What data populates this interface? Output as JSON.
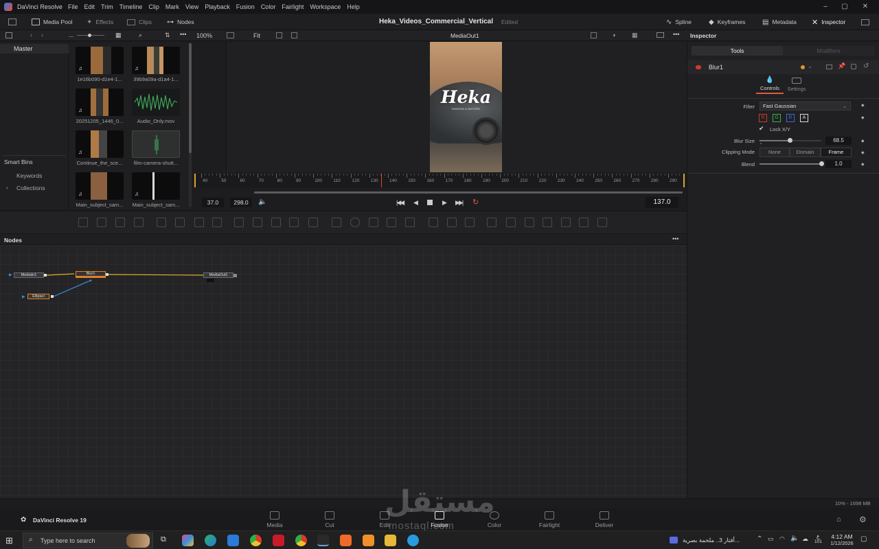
{
  "app": {
    "name": "DaVinci Resolve",
    "menu": [
      "File",
      "Edit",
      "Trim",
      "Timeline",
      "Clip",
      "Mark",
      "View",
      "Playback",
      "Fusion",
      "Color",
      "Fairlight",
      "Workspace",
      "Help"
    ]
  },
  "toolbar": {
    "media_pool": "Media Pool",
    "effects": "Effects",
    "clips": "Clips",
    "nodes": "Nodes",
    "project_title": "Heka_Videos_Commercial_Vertical",
    "edited": "Edited",
    "spline": "Spline",
    "keyframes": "Keyframes",
    "metadata": "Metadata",
    "inspector": "Inspector"
  },
  "subbar": {
    "zoom": "100%",
    "fit": "Fit",
    "viewer_name": "MediaOut1",
    "inspector_label": "Inspector"
  },
  "bins": {
    "master": "Master",
    "smart_bins": "Smart Bins",
    "keywords": "Keywords",
    "collections": "Collections"
  },
  "clips": [
    {
      "label": "1e16b090-d1e4-1...",
      "kind": "video"
    },
    {
      "label": "39b9a09a-d1a4-1...",
      "kind": "video"
    },
    {
      "label": "20251205_1446_0...",
      "kind": "video"
    },
    {
      "label": "Audio_Only.mov",
      "kind": "audio"
    },
    {
      "label": "Continue_the_sce...",
      "kind": "video"
    },
    {
      "label": "film-camera-shutt...",
      "kind": "audio"
    },
    {
      "label": "Main_subject_sam...",
      "kind": "video"
    },
    {
      "label": "Main_subject_sam...",
      "kind": "video"
    }
  ],
  "viewer": {
    "overlay_title": "Heka",
    "overlay_sub": "FASHION & MOTORS"
  },
  "timeline": {
    "ruler": [
      "40",
      "50",
      "60",
      "70",
      "80",
      "90",
      "100",
      "110",
      "120",
      "130",
      "140",
      "150",
      "160",
      "170",
      "180",
      "190",
      "200",
      "210",
      "220",
      "230",
      "240",
      "250",
      "260",
      "270",
      "280",
      "290"
    ],
    "in": "37.0",
    "out": "298.0",
    "current": "137.0"
  },
  "nodes": {
    "title": "Nodes",
    "items": [
      "MediaIn1",
      "Blur1",
      "MediaOut1",
      "EllipseI"
    ]
  },
  "inspector": {
    "tabs": [
      "Tools",
      "Modifiers"
    ],
    "tool_name": "Blur1",
    "subtabs": [
      "Controls",
      "Settings"
    ],
    "filter_label": "Filter",
    "filter_value": "Fast Gaussian",
    "channels": [
      "R",
      "G",
      "B",
      "A"
    ],
    "lock_label": "Lock X/Y",
    "blur_label": "Blur Size",
    "blur_value": "68.5",
    "blur_fraction": 0.49,
    "clip_label": "Clipping Mode",
    "clip_options": [
      "None",
      "Domain",
      "Frame"
    ],
    "blend_label": "Blend",
    "blend_value": "1.0",
    "blend_fraction": 1.0
  },
  "status": "10% - 1698 MB",
  "bottom_nav": {
    "product": "DaVinci Resolve 19",
    "pages": [
      "Media",
      "Cut",
      "Edit",
      "Fusion",
      "Color",
      "Fairlight",
      "Deliver"
    ]
  },
  "watermark": {
    "text": "mostaql.com"
  },
  "taskbar": {
    "search_placeholder": "Type here to search",
    "notification_text": "أفتار 3.. ملحمة بصرية...",
    "time": "4:12 AM",
    "date": "1/12/2026",
    "lang": "ع",
    "lang_sub": "101"
  },
  "colors": {
    "accent_orange": "#e0812a",
    "playhead": "#d94a2a",
    "link_yellow": "#d8b22a",
    "link_blue": "#3a8fd8"
  }
}
